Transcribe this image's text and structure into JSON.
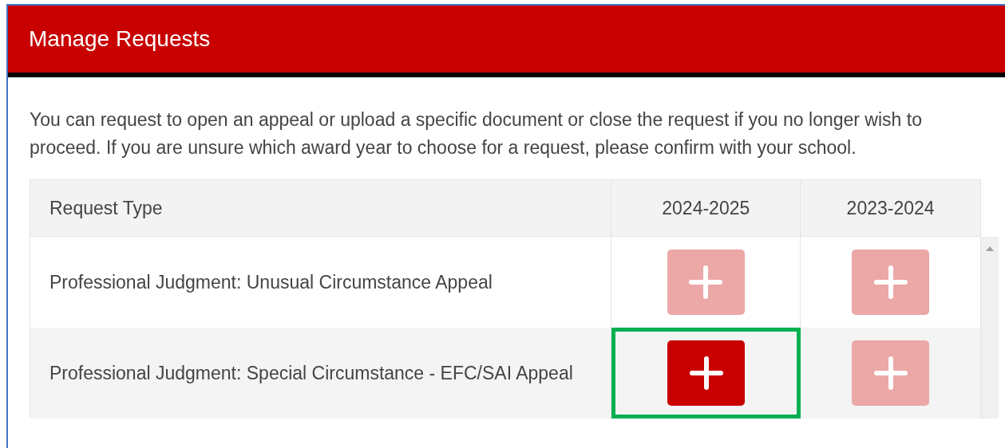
{
  "panel": {
    "title": "Manage Requests",
    "intro": "You can request to open an appeal or upload a specific document or close the request if you no longer wish to proceed. If you are unsure which award year to choose for a request, please confirm with your school."
  },
  "table": {
    "columns": [
      "Request Type",
      "2024-2025",
      "2023-2024"
    ],
    "rows": [
      {
        "request_type": "Professional Judgment: Unusual Circumstance Appeal",
        "actions": [
          {
            "enabled": false,
            "highlighted": false
          },
          {
            "enabled": false,
            "highlighted": false
          }
        ]
      },
      {
        "request_type": "Professional Judgment: Special Circumstance - EFC/SAI Appeal",
        "actions": [
          {
            "enabled": true,
            "highlighted": true
          },
          {
            "enabled": false,
            "highlighted": false
          }
        ]
      }
    ]
  }
}
